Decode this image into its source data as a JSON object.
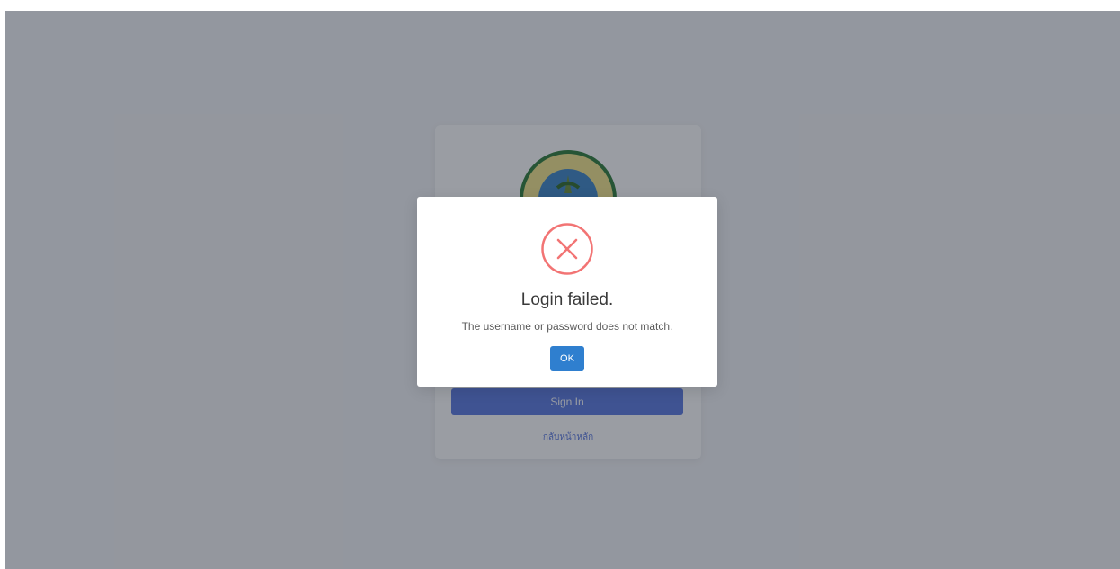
{
  "login": {
    "seal_alt": "เทศบาลตำบลป่าไผ่",
    "signin_label": "Sign In",
    "home_link_label": "กลับหน้าหลัก",
    "accent_color": "#5a78e0"
  },
  "dialog": {
    "icon": "error-x-icon",
    "title": "Login failed.",
    "message": "The username or password does not match.",
    "ok_label": "OK",
    "icon_color": "#f27474",
    "ok_color": "#2f7fcf"
  }
}
